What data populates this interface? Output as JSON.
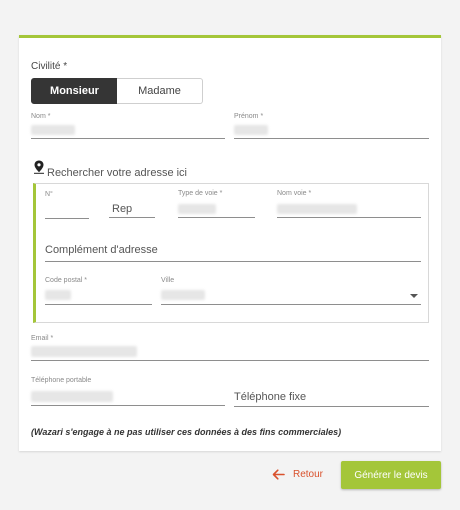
{
  "form": {
    "civility": {
      "label": "Civilité *",
      "options": [
        "Monsieur",
        "Madame"
      ],
      "selected": "Monsieur"
    },
    "nom_label": "Nom *",
    "prenom_label": "Prénom *",
    "address_search_placeholder": "Rechercher votre adresse ici",
    "address": {
      "numero_label": "N°",
      "rep_placeholder": "Rep",
      "type_voie_label": "Type de voie *",
      "nom_voie_label": "Nom voie *",
      "complement_placeholder": "Complément d'adresse",
      "code_postal_label": "Code postal *",
      "ville_label": "Ville"
    },
    "email_label": "Email *",
    "tel_portable_label": "Téléphone portable",
    "tel_fixe_placeholder": "Téléphone fixe",
    "disclaimer": "(Wazari s'engage à ne pas utiliser ces données à des fins commerciales)"
  },
  "actions": {
    "back_label": "Retour",
    "submit_label": "Générer le devis"
  },
  "colors": {
    "accent": "#a4c639",
    "back": "#d9512c",
    "selected_segment": "#353535"
  }
}
